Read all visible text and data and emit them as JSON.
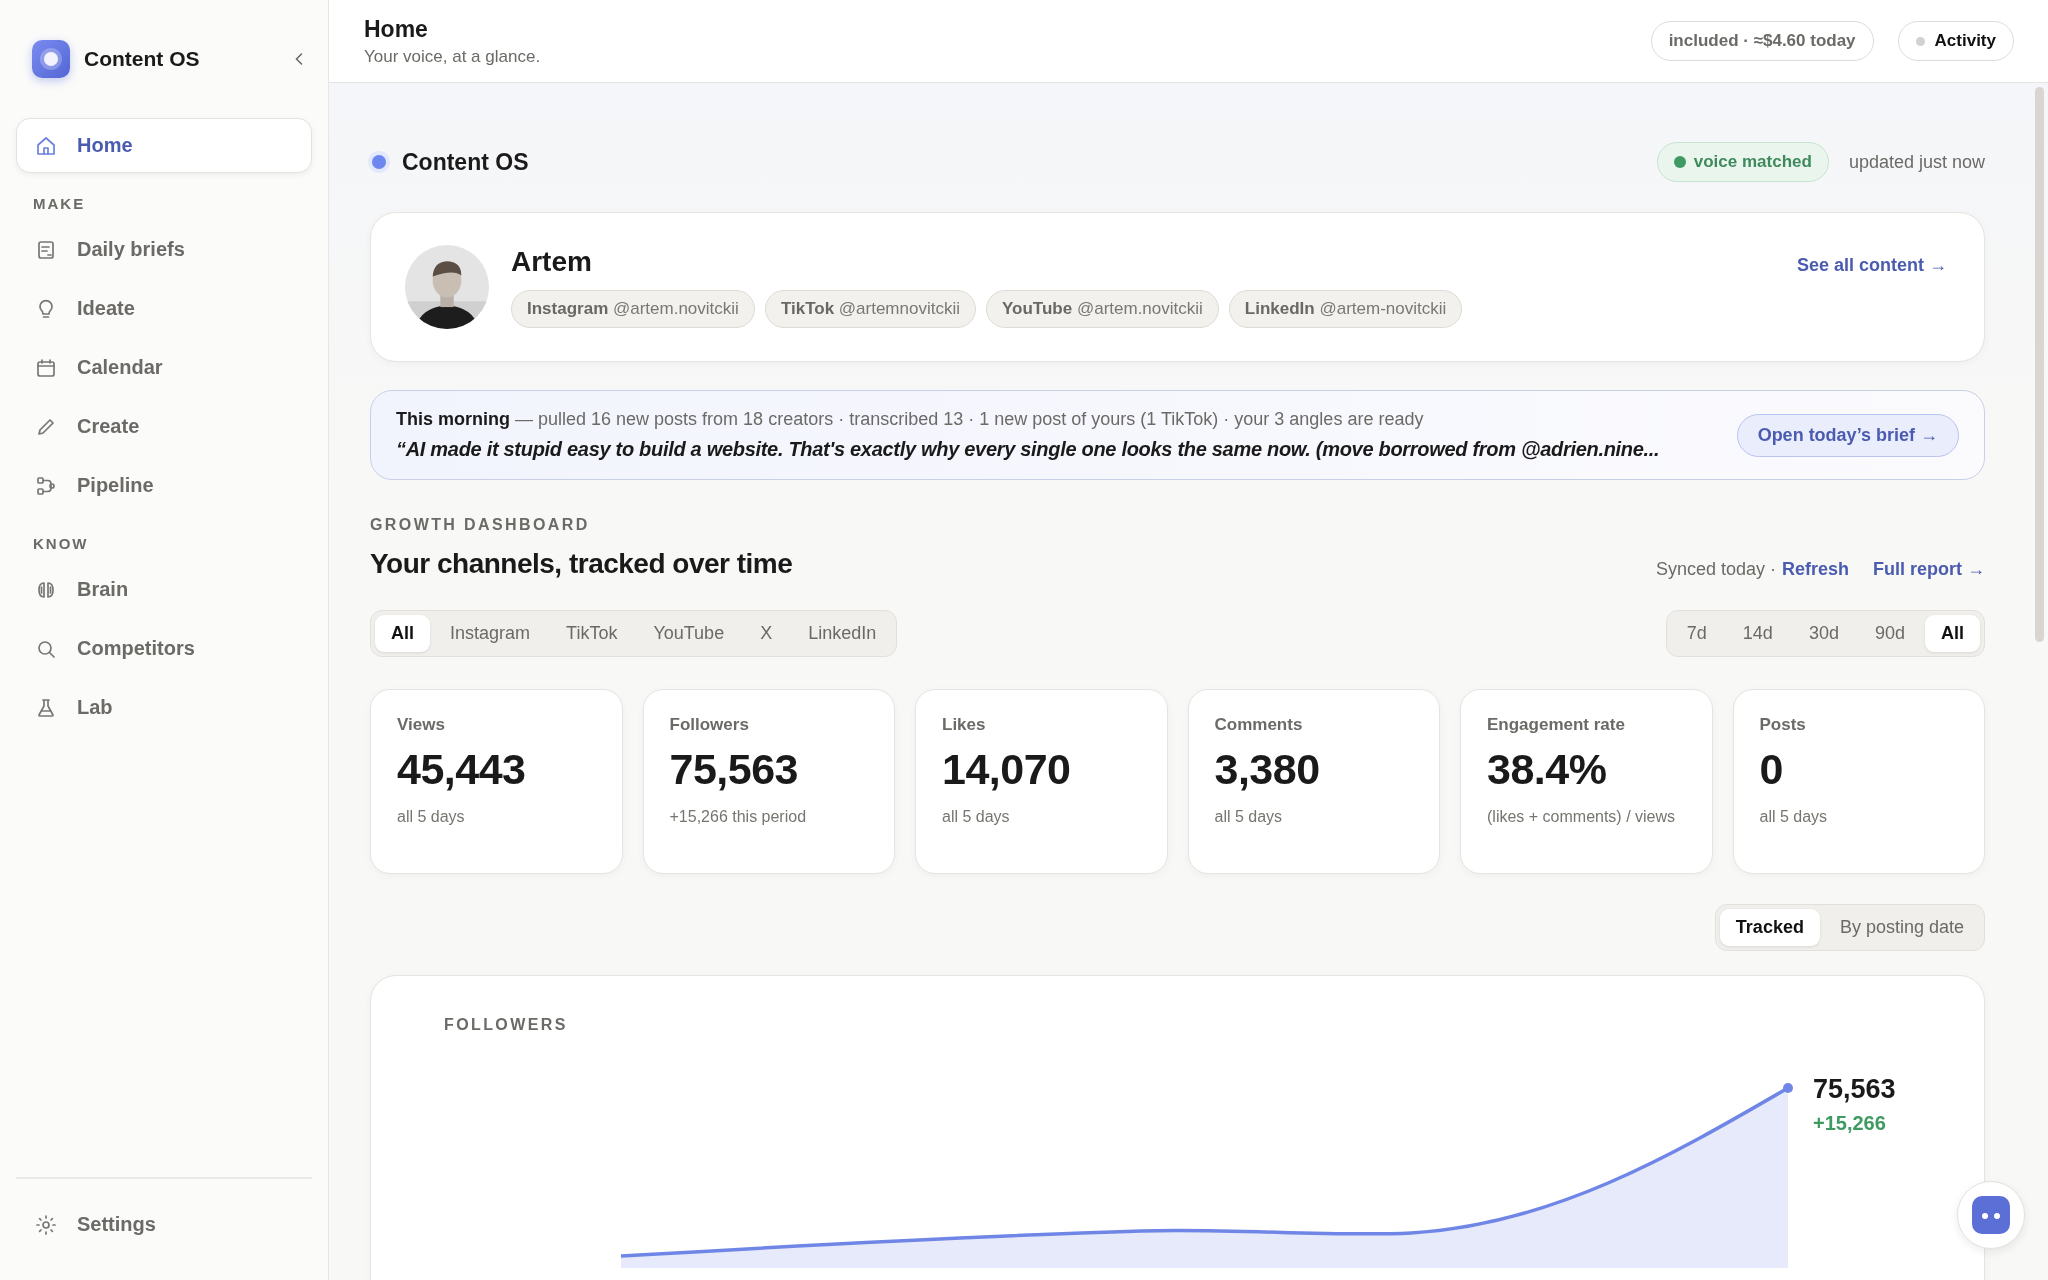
{
  "sidebar": {
    "brand": "Content OS",
    "top_items": [
      {
        "label": "Home",
        "selected": true
      }
    ],
    "sections": [
      {
        "heading": "MAKE",
        "items": [
          {
            "label": "Daily briefs",
            "selected": false
          },
          {
            "label": "Ideate",
            "selected": false
          },
          {
            "label": "Calendar",
            "selected": false
          },
          {
            "label": "Create",
            "selected": false
          },
          {
            "label": "Pipeline",
            "selected": false
          }
        ]
      },
      {
        "heading": "KNOW",
        "items": [
          {
            "label": "Brain",
            "selected": false
          },
          {
            "label": "Competitors",
            "selected": false
          },
          {
            "label": "Lab",
            "selected": false
          }
        ]
      }
    ],
    "footer_items": [
      {
        "label": "Settings",
        "selected": false
      }
    ]
  },
  "header": {
    "title": "Home",
    "subtitle": "Your voice, at a glance.",
    "usage": "included · ≈$4.60 today",
    "activity": "Activity"
  },
  "hero": {
    "title": "Content OS",
    "badge": "voice matched",
    "updated": "updated just now"
  },
  "profile": {
    "name": "Artem",
    "link": "See all content →",
    "handles": [
      {
        "platform": "Instagram",
        "handle": "@artem.novitckii"
      },
      {
        "platform": "TikTok",
        "handle": "@artemnovitckii"
      },
      {
        "platform": "YouTube",
        "handle": "@artem.novitckii"
      },
      {
        "platform": "LinkedIn",
        "handle": "@artem-novitckii"
      }
    ]
  },
  "brief": {
    "lead": "**This morning** — pulled 16 new posts from 18 creators · transcribed 13 · 1 new post of yours (1 TikTok) · your 3 angles are ready",
    "quote": "“AI made it stupid easy to build a website. That's exactly why every single one looks the same now. (move borrowed from @adrien.nine...",
    "button": "Open today’s brief →"
  },
  "dashboard": {
    "eyebrow": "GROWTH DASHBOARD",
    "title": "Your channels, tracked over time",
    "synced": "Synced today ·",
    "refresh": "Refresh",
    "report": "Full report →",
    "channels": [
      {
        "label": "All",
        "selected": true
      },
      {
        "label": "Instagram",
        "selected": false
      },
      {
        "label": "TikTok",
        "selected": false
      },
      {
        "label": "YouTube",
        "selected": false
      },
      {
        "label": "X",
        "selected": false
      },
      {
        "label": "LinkedIn",
        "selected": false
      }
    ],
    "ranges": [
      {
        "label": "7d",
        "selected": false
      },
      {
        "label": "14d",
        "selected": false
      },
      {
        "label": "30d",
        "selected": false
      },
      {
        "label": "90d",
        "selected": false
      },
      {
        "label": "All",
        "selected": true
      }
    ],
    "stats": [
      {
        "label": "Views",
        "value": "45,443",
        "note": "all 5 days"
      },
      {
        "label": "Followers",
        "value": "75,563",
        "note": "+15,266 this period"
      },
      {
        "label": "Likes",
        "value": "14,070",
        "note": "all 5 days"
      },
      {
        "label": "Comments",
        "value": "3,380",
        "note": "all 5 days"
      },
      {
        "label": "Engagement rate",
        "value": "38.4%",
        "note": "(likes + comments) / views"
      },
      {
        "label": "Posts",
        "value": "0",
        "note": "all 5 days"
      }
    ],
    "modes": [
      {
        "label": "Tracked",
        "selected": true
      },
      {
        "label": "By posting date",
        "selected": false
      }
    ]
  },
  "chart": {
    "title": "FOLLOWERS",
    "value": "75,563",
    "delta": "+15,266"
  }
}
